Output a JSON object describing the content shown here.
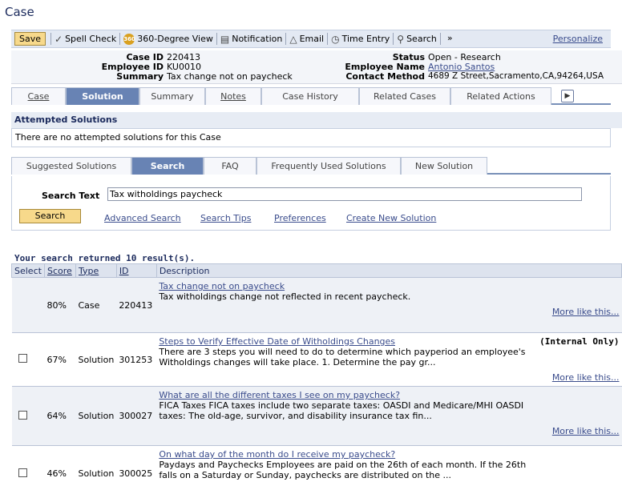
{
  "page": {
    "title": "Case"
  },
  "toolbar": {
    "save": "Save",
    "items": [
      "Spell Check",
      "360-Degree View",
      "Notification",
      "Email",
      "Time Entry",
      "Search"
    ],
    "more": "»",
    "personalize": "Personalize",
    "badge_360": "360"
  },
  "header": {
    "case_id_label": "Case ID",
    "case_id": "220413",
    "employee_id_label": "Employee ID",
    "employee_id": "KU0010",
    "summary_label": "Summary",
    "summary": "Tax change not on paycheck",
    "status_label": "Status",
    "status": "Open - Research",
    "employee_name_label": "Employee Name",
    "employee_name": "Antonio Santos",
    "contact_method_label": "Contact Method",
    "contact_method": "4689 Z Street,Sacramento,CA,94264,USA"
  },
  "main_tabs": [
    "Case",
    "Solution",
    "Summary",
    "Notes",
    "Case History",
    "Related Cases",
    "Related Actions"
  ],
  "attempted": {
    "heading": "Attempted Solutions",
    "message": "There are no attempted solutions for this Case"
  },
  "solution_tabs": [
    "Suggested Solutions",
    "Search",
    "FAQ",
    "Frequently Used Solutions",
    "New Solution"
  ],
  "search": {
    "label": "Search Text",
    "value": "Tax witholdings paycheck",
    "button": "Search",
    "links": [
      "Advanced Search",
      "Search Tips",
      "Preferences",
      "Create New Solution"
    ]
  },
  "results": {
    "count_text": "Your search returned 10 result(s).",
    "columns": [
      "Select",
      "Score",
      "Type",
      "ID",
      "Description"
    ],
    "more_like": "More like this...",
    "rows": [
      {
        "score": "80%",
        "type": "Case",
        "id": "220413",
        "title": "Tax change not on paycheck",
        "text": "Tax witholdings change not reflected in recent paycheck.",
        "internal": ""
      },
      {
        "score": "67%",
        "type": "Solution",
        "id": "301253",
        "title": "Steps to Verify Effective Date of Witholdings Changes",
        "text": "There are 3 steps you will need to do to determine which payperiod an employee's Witholdings changes will take place. 1. Determine the pay gr...",
        "internal": "(Internal Only)"
      },
      {
        "score": "64%",
        "type": "Solution",
        "id": "300027",
        "title": "What are all the different taxes I see on my paycheck?",
        "text": "FICA Taxes FICA taxes include two separate taxes: OASDI and Medicare/MHI OASDI taxes: The old-age, survivor, and disability insurance tax fin...",
        "internal": ""
      },
      {
        "score": "46%",
        "type": "Solution",
        "id": "300025",
        "title": "On what day of the month do I receive my paycheck?",
        "text": "Paydays and Paychecks Employees are paid on the 26th of each month. If the 26th falls on a Saturday or Sunday, paychecks are distributed on the ...",
        "internal": ""
      }
    ]
  }
}
